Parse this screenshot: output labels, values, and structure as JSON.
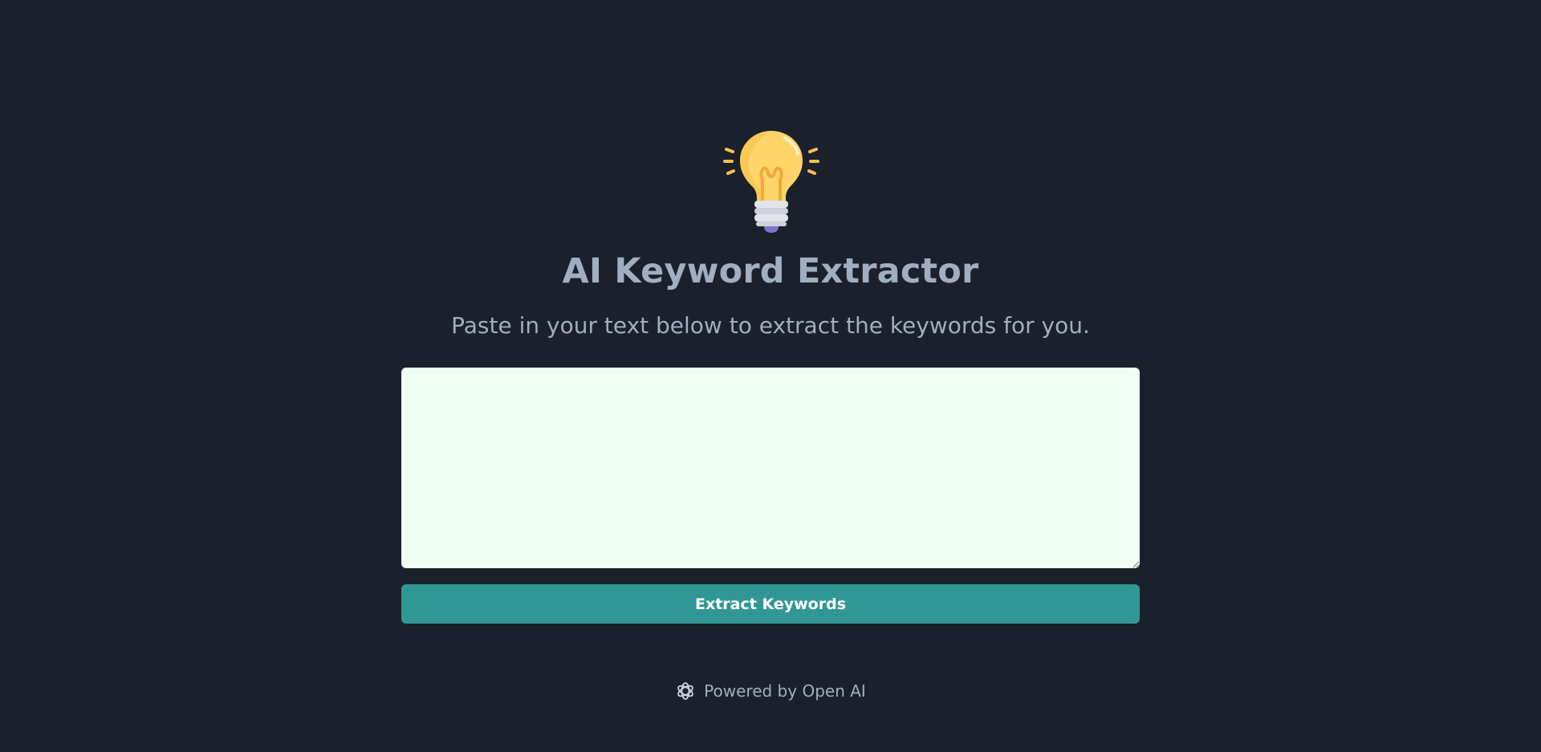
{
  "header": {
    "title": "AI Keyword Extractor",
    "subtitle": "Paste in your text below to extract the keywords for you.",
    "icon": "lightbulb-icon"
  },
  "form": {
    "textarea_value": "",
    "button_label": "Extract Keywords"
  },
  "footer": {
    "powered_by": "Powered by Open AI",
    "icon": "openai-icon"
  },
  "colors": {
    "background": "#1a202c",
    "text": "#a0aec0",
    "textarea_bg": "#f0fff4",
    "button_bg": "#319795",
    "button_text": "#ffffff",
    "bulb_glass": "#ffd469",
    "bulb_base": "#e2e4ec",
    "bulb_tip": "#7e76c9"
  }
}
